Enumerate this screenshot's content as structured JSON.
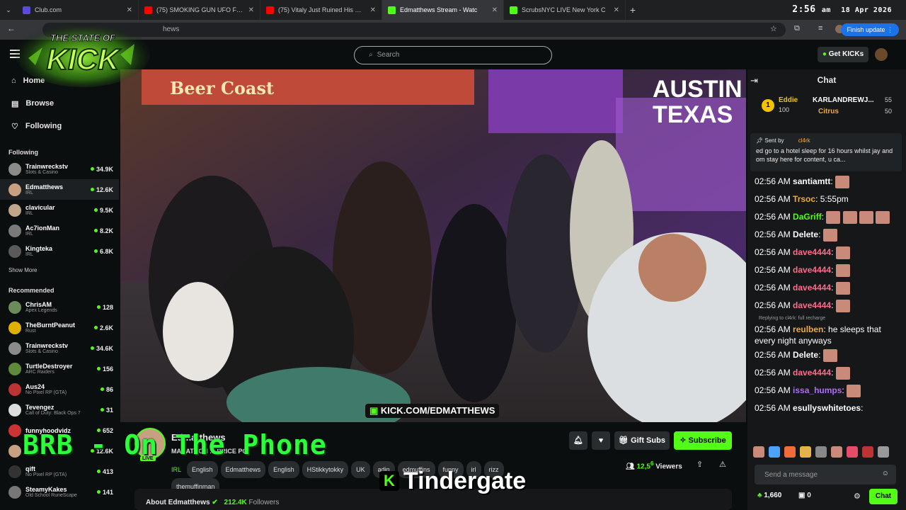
{
  "browser": {
    "tabs": [
      {
        "title": "Club.com",
        "color": "#5b4bd6"
      },
      {
        "title": "(75) SMOKING GUN UFO FOOT",
        "color": "#ff0000"
      },
      {
        "title": "(75) Vitaly Just Ruined His Care",
        "color": "#ff0000"
      },
      {
        "title": "Edmatthews Stream - Watc",
        "color": "#53fc18"
      },
      {
        "title": "ScrubsNYC LIVE New York C",
        "color": "#53fc18"
      }
    ],
    "time": "2:56",
    "ampm": "am",
    "date": "18 Apr 2026",
    "url": "hews",
    "finish_update": "Finish update"
  },
  "logo": {
    "line1": "THE STATE OF",
    "line2": "KICK"
  },
  "header": {
    "search_placeholder": "Search",
    "get_kicks": "Get KICKs"
  },
  "sidebar": {
    "nav": [
      {
        "label": "Home"
      },
      {
        "label": "Browse"
      },
      {
        "label": "Following"
      }
    ],
    "following_title": "Following",
    "following": [
      {
        "name": "Trainwreckstv",
        "cat": "Slots & Casino",
        "viewers": "34.9K",
        "color": "#8b8b8b"
      },
      {
        "name": "Edmatthews",
        "cat": "IRL",
        "viewers": "12.6K",
        "color": "#c6a080"
      },
      {
        "name": "clavicular",
        "cat": "IRL",
        "viewers": "9.5K",
        "color": "#bfa58a"
      },
      {
        "name": "Ac7ionMan",
        "cat": "IRL",
        "viewers": "8.2K",
        "color": "#7a7a7a"
      },
      {
        "name": "Kingteka",
        "cat": "IRL",
        "viewers": "6.8K",
        "color": "#5a5a5a"
      }
    ],
    "show_more": "Show More",
    "recommended_title": "Recommended",
    "recommended": [
      {
        "name": "ChrisAM",
        "cat": "Apex Legends",
        "viewers": "128",
        "color": "#6b8b5b"
      },
      {
        "name": "TheBurntPeanut",
        "cat": "Rust",
        "viewers": "2.6K",
        "color": "#e0b000"
      },
      {
        "name": "Trainwreckstv",
        "cat": "Slots & Casino",
        "viewers": "34.6K",
        "color": "#8b8b8b"
      },
      {
        "name": "TurtleDestroyer",
        "cat": "ARC Raiders",
        "viewers": "156",
        "color": "#5f8a3a"
      },
      {
        "name": "Aus24",
        "cat": "No Pixel RP (GTA)",
        "viewers": "86",
        "color": "#b33"
      },
      {
        "name": "Tevengez",
        "cat": "Call of Duty: Black Ops 7",
        "viewers": "31",
        "color": "#ddd"
      },
      {
        "name": "funnyhoodvidz",
        "cat": "",
        "viewers": "652",
        "color": "#c33"
      },
      {
        "name": "",
        "cat": "",
        "viewers": "12.6K",
        "color": "#c6a080"
      },
      {
        "name": "qift",
        "cat": "No Pixel RP (GTA)",
        "viewers": "413",
        "color": "#333"
      },
      {
        "name": "SteamyKakes",
        "cat": "Old School RuneScape",
        "viewers": "141",
        "color": "#777"
      }
    ]
  },
  "video": {
    "austin": "AUSTIN",
    "texas": "TEXAS",
    "sign": "Beer Coast",
    "watermark": "KICK.COM/EDMATTHEWS"
  },
  "overlay": {
    "brb": "BRB - On The Phone",
    "tindergate": "Tindergate"
  },
  "stream": {
    "streamer": "Edmatthews",
    "title": "MARATHON ... PRICE PO",
    "category": "IRL",
    "tags": [
      "English",
      "Edmatthews",
      "English",
      "HStikkytokky",
      "UK",
      "adin",
      "edmuffins",
      "funny",
      "irl",
      "rizz",
      "themuffinman"
    ],
    "gift_subs": "Gift Subs",
    "subscribe": "Subscribe",
    "viewers_value": "12,5",
    "viewers_value_small": "6",
    "viewers_label": "Viewers",
    "about": "About Edmatthews",
    "followers_value": "212.4K",
    "followers_label": "Followers",
    "live_badge": "LIVE"
  },
  "chat": {
    "title": "Chat",
    "leaders": {
      "rank": "1",
      "top": "Eddie",
      "top_val": "100",
      "second": "KARLANDREWJ...",
      "second_val": "55",
      "third": "Citrus",
      "third_val": "50"
    },
    "pinned_by_label": "Sent by",
    "pinned_user": "cl4rk",
    "pinned_text": "ed go to a hotel sleep for 16 hours whilst jay and om stay here for content, u ca...",
    "messages": [
      {
        "time": "02:56 AM",
        "user": "santiamtt",
        "ucolor": "#fff",
        "text": ":",
        "emotes": 1
      },
      {
        "time": "02:56 AM",
        "user": "Trsoc",
        "ucolor": "#f2a93b",
        "text": ": 5:55pm",
        "emotes": 0
      },
      {
        "time": "02:56 AM",
        "user": "DaGriff",
        "ucolor": "#53fc18",
        "text": ":",
        "emotes": 4
      },
      {
        "time": "02:56 AM",
        "user": "Delete",
        "ucolor": "#fff",
        "text": ":",
        "emotes": 1
      },
      {
        "time": "02:56 AM",
        "user": "dave4444",
        "ucolor": "#ff6b8a",
        "text": ":",
        "emotes": 1
      },
      {
        "time": "02:56 AM",
        "user": "dave4444",
        "ucolor": "#ff6b8a",
        "text": ":",
        "emotes": 1
      },
      {
        "time": "02:56 AM",
        "user": "dave4444",
        "ucolor": "#ff6b8a",
        "text": ":",
        "emotes": 1
      },
      {
        "time": "02:56 AM",
        "user": "dave4444",
        "ucolor": "#ff6b8a",
        "text": ":",
        "emotes": 1
      }
    ],
    "reply_hint": "Replying to cl4rk: full recharge",
    "messages2": [
      {
        "time": "02:56 AM",
        "user": "reulben",
        "ucolor": "#f2a93b",
        "text": ": he sleeps that every night anyways",
        "emotes": 0
      },
      {
        "time": "02:56 AM",
        "user": "Delete",
        "ucolor": "#fff",
        "text": ":",
        "emotes": 1
      },
      {
        "time": "02:56 AM",
        "user": "dave4444",
        "ucolor": "#ff6b8a",
        "text": ":",
        "emotes": 1
      },
      {
        "time": "02:56 AM",
        "user": "issa_humps",
        "ucolor": "#b06bff",
        "text": ":",
        "emotes": 1
      },
      {
        "time": "02:56 AM",
        "user": "esullyswhitetoes",
        "ucolor": "#fff",
        "text": ":",
        "emotes": 0
      }
    ],
    "send_placeholder": "Send a message",
    "points": "1,660",
    "gifts": "0",
    "chat_button": "Chat"
  }
}
